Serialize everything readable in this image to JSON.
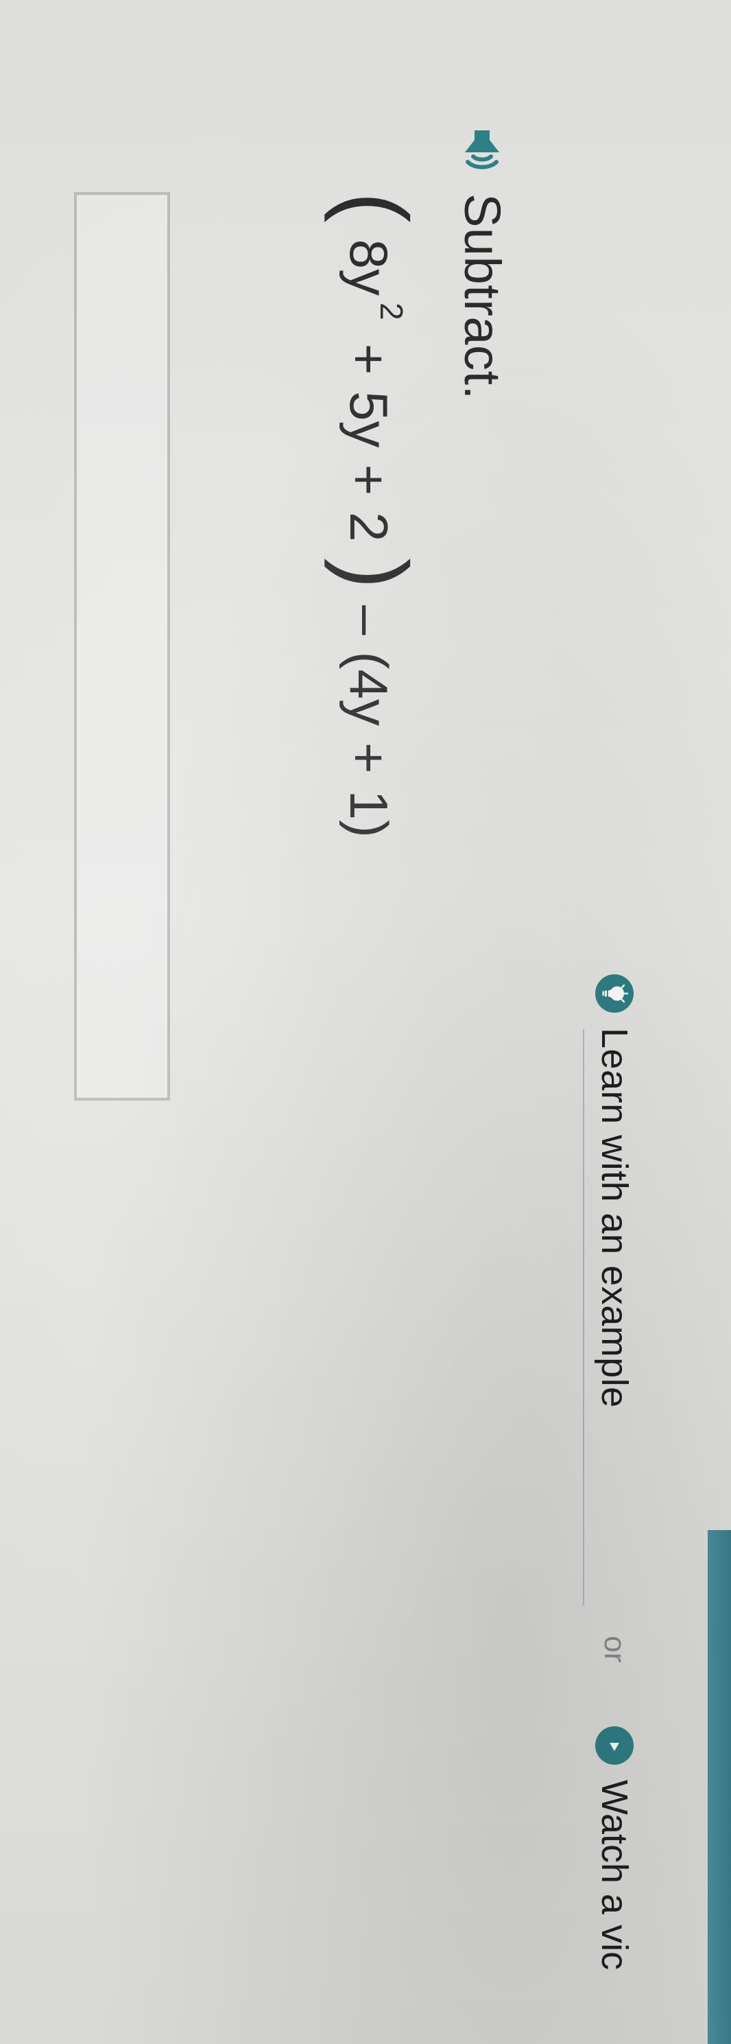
{
  "header": {
    "learn_label": "Learn with an example",
    "or_label": "or",
    "watch_label": "Watch a vic"
  },
  "icons": {
    "bulb": "lightbulb-icon",
    "play": "play-icon",
    "speaker": "speaker-icon"
  },
  "colors": {
    "accent": "#2f7f86",
    "text": "#2a2a2a",
    "muted": "#8a8a8a",
    "edge": "#3b7e8d"
  },
  "question": {
    "instruction": "Subtract.",
    "expression": {
      "lp": "(",
      "t1": "8y",
      "t1_exp": "2",
      "plus1": "+",
      "t2": "5y",
      "plus2": "+",
      "t3": "2",
      "rp": ")",
      "minus": "–",
      "p2_open": "(4y",
      "plus3": "+",
      "p2_close": "1)"
    }
  }
}
